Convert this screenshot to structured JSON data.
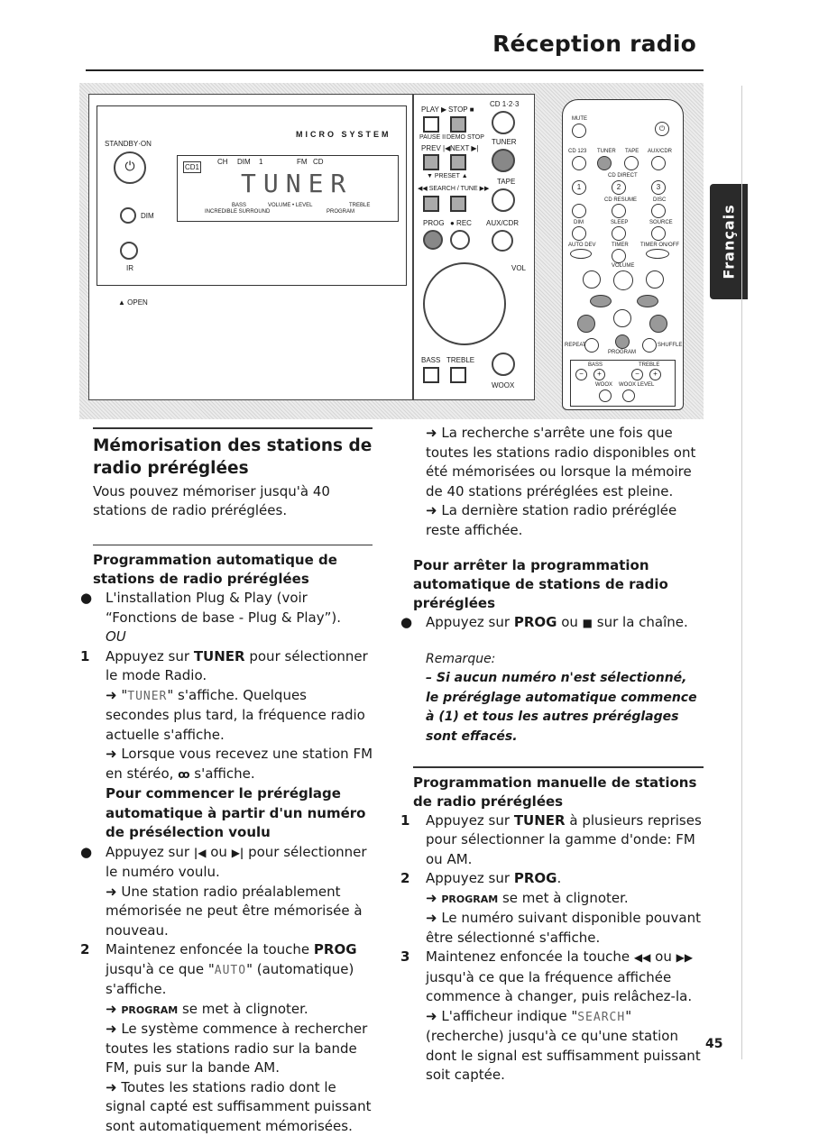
{
  "header": {
    "title": "Réception radio"
  },
  "side_tab": {
    "label": "Français"
  },
  "illustration": {
    "unit": {
      "brand": "MICRO SYSTEM",
      "standby": "STANDBY·ON",
      "dim": "DIM",
      "ir": "IR",
      "open": "▲ OPEN",
      "display": {
        "main": "TUNER",
        "cd1": "CD1",
        "top": [
          "CH",
          "DIM",
          "1",
          "FM",
          "CD"
        ],
        "bass": "BASS",
        "surround": "INCREDIBLE SURROUND",
        "volume": "VOLUME • LEVEL",
        "treble": "TREBLE",
        "program": "PROGRAM"
      }
    },
    "controls": {
      "play": "PLAY ▶",
      "stop": "STOP ■",
      "cd123": "CD 1·2·3",
      "pause": "PAUSE II",
      "demo": "DEMO STOP",
      "tuner": "TUNER",
      "prev": "PREV |◀",
      "next": "NEXT ▶|",
      "preset": "▼ PRESET ▲",
      "search": "◀◀ SEARCH / TUNE ▶▶",
      "tape": "TAPE",
      "prog": "PROG",
      "rec": "● REC",
      "aux": "AUX/CDR",
      "vol": "VOL",
      "bass": "BASS",
      "treble": "TREBLE",
      "wook": "WOOX"
    },
    "remote": {
      "labels": [
        "MUTE",
        "CD 123",
        "TUNER",
        "TAPE",
        "AUX/CDR",
        "CD DIRECT",
        "1",
        "2",
        "3",
        "CD RESUME",
        "DISC",
        "DIM",
        "SLEEP",
        "SOURCE",
        "AUTO DEV",
        "TIMER",
        "TIMER ON/OFF",
        "VOLUME",
        "REPEAT",
        "PROGRAM",
        "SHUFFLE",
        "BASS",
        "TREBLE",
        "WOOX",
        "WOOX LEVEL"
      ]
    }
  },
  "left_column": [
    {
      "k": "rule"
    },
    {
      "k": "h2",
      "segs": [
        "Mémorisation des stations de radio préréglées"
      ]
    },
    {
      "k": "p",
      "segs": [
        "Vous pouvez mémoriser jusqu'à 40 stations de radio préréglées."
      ]
    },
    {
      "k": "gap"
    },
    {
      "k": "rule"
    },
    {
      "k": "h3",
      "segs": [
        "Programmation automatique de stations de radio préréglées"
      ]
    },
    {
      "k": "blk",
      "mk": "●",
      "segs": [
        "L'installation Plug & Play (voir “Fonctions de base - Plug & Play”)."
      ]
    },
    {
      "k": "blk",
      "segs": [
        {
          "s": "i",
          "t": "OU"
        }
      ]
    },
    {
      "k": "blk",
      "mk": "1",
      "segs": [
        "Appuyez sur ",
        {
          "s": "b",
          "t": "TUNER"
        },
        " pour sélectionner le mode Radio."
      ]
    },
    {
      "k": "blk",
      "segs": [
        "➜ \"",
        {
          "s": "lcd",
          "t": "TUNER"
        },
        "\" s'affiche. Quelques secondes plus tard, la fréquence radio actuelle s'affiche."
      ]
    },
    {
      "k": "blk",
      "segs": [
        "➜ Lorsque vous recevez une station FM en stéréo, ",
        {
          "s": "ic",
          "t": "ꝏ"
        },
        " s'affiche."
      ]
    },
    {
      "k": "blk",
      "h": true,
      "segs": [
        "Pour commencer le préréglage automatique à partir d'un numéro de présélection voulu"
      ]
    },
    {
      "k": "blk",
      "mk": "●",
      "segs": [
        "Appuyez sur ",
        {
          "s": "ic",
          "t": "|◀"
        },
        " ou ",
        {
          "s": "ic",
          "t": "▶|"
        },
        " pour sélectionner le numéro voulu."
      ]
    },
    {
      "k": "blk",
      "segs": [
        "➜ Une station radio préalablement mémorisée ne peut être mémorisée à nouveau."
      ]
    },
    {
      "k": "blk",
      "mk": "2",
      "segs": [
        "Maintenez enfoncée la touche ",
        {
          "s": "b",
          "t": "PROG"
        },
        " jusqu'à ce que \"",
        {
          "s": "lcd",
          "t": "AUTO"
        },
        "\" (automatique) s'affiche."
      ]
    },
    {
      "k": "blk",
      "segs": [
        "➜ ",
        {
          "s": "sc",
          "t": "PROGRAM"
        },
        " se met à clignoter."
      ]
    },
    {
      "k": "blk",
      "segs": [
        "➜ Le système commence à rechercher toutes les stations radio sur la bande FM, puis sur la bande AM."
      ]
    },
    {
      "k": "blk",
      "segs": [
        "➜ Toutes les stations radio dont le signal capté est suffisamment puissant sont automatiquement mémorisées."
      ]
    }
  ],
  "right_column": [
    {
      "k": "blk",
      "segs": [
        "➜ La recherche s'arrête une fois que toutes les stations radio disponibles ont été mémorisées ou lorsque la mémoire de 40 stations préréglées est pleine."
      ]
    },
    {
      "k": "blk",
      "segs": [
        "➜ La dernière station radio préréglée reste affichée."
      ]
    },
    {
      "k": "gap"
    },
    {
      "k": "h3",
      "segs": [
        "Pour arrêter la programmation automatique de stations de radio préréglées"
      ]
    },
    {
      "k": "blk",
      "mk": "●",
      "segs": [
        "Appuyez sur ",
        {
          "s": "b",
          "t": "PROG"
        },
        " ou ",
        {
          "s": "ic",
          "t": "■"
        },
        " sur la chaîne."
      ]
    },
    {
      "k": "gap"
    },
    {
      "k": "blk",
      "rem": true,
      "segs": [
        "Remarque:"
      ]
    },
    {
      "k": "blk",
      "rem": true,
      "b": true,
      "segs": [
        "– Si aucun numéro n'est sélectionné, le préréglage automatique commence à (1) et tous les autres préréglages sont effacés."
      ]
    },
    {
      "k": "gap"
    },
    {
      "k": "rule"
    },
    {
      "k": "h3",
      "segs": [
        "Programmation manuelle de stations de radio préréglées"
      ]
    },
    {
      "k": "blk",
      "mk": "1",
      "segs": [
        "Appuyez sur ",
        {
          "s": "b",
          "t": "TUNER"
        },
        " à plusieurs reprises pour sélectionner la gamme d'onde: FM ou AM."
      ]
    },
    {
      "k": "blk",
      "mk": "2",
      "segs": [
        "Appuyez sur ",
        {
          "s": "b",
          "t": "PROG"
        },
        "."
      ]
    },
    {
      "k": "blk",
      "segs": [
        "➜ ",
        {
          "s": "sc",
          "t": "PROGRAM"
        },
        " se met à clignoter."
      ]
    },
    {
      "k": "blk",
      "segs": [
        "➜ Le numéro suivant disponible pouvant être sélectionné s'affiche."
      ]
    },
    {
      "k": "blk",
      "mk": "3",
      "segs": [
        "Maintenez enfoncée la touche ",
        {
          "s": "ic",
          "t": "◀◀"
        },
        " ou ",
        {
          "s": "ic",
          "t": "▶▶"
        },
        " jusqu'à ce que la fréquence affichée commence à changer, puis relâchez-la."
      ]
    },
    {
      "k": "blk",
      "segs": [
        "➜ L'afficheur indique \"",
        {
          "s": "lcd",
          "t": "SEARCH"
        },
        "\" (recherche) jusqu'à ce qu'une station dont le signal est suffisamment puissant soit captée."
      ]
    }
  ],
  "footer": {
    "page_number": "45"
  }
}
